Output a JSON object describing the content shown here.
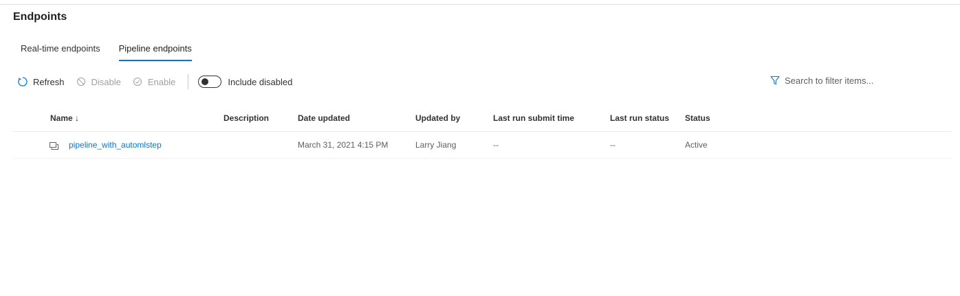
{
  "page": {
    "title": "Endpoints"
  },
  "tabs": [
    {
      "label": "Real-time endpoints",
      "active": false
    },
    {
      "label": "Pipeline endpoints",
      "active": true
    }
  ],
  "toolbar": {
    "refresh_label": "Refresh",
    "disable_label": "Disable",
    "enable_label": "Enable",
    "include_disabled_label": "Include disabled",
    "include_disabled_on": false
  },
  "search": {
    "placeholder": "Search to filter items..."
  },
  "table": {
    "columns": [
      "Name ↓",
      "Description",
      "Date updated",
      "Updated by",
      "Last run submit time",
      "Last run status",
      "Status"
    ],
    "rows": [
      {
        "name": "pipeline_with_automlstep",
        "description": "",
        "date_updated": "March 31, 2021 4:15 PM",
        "updated_by": "Larry Jiang",
        "last_run_submit_time": "--",
        "last_run_status": "--",
        "status": "Active"
      }
    ]
  },
  "colors": {
    "accent": "#0078d4",
    "text": "#323130",
    "disabled": "#a19f9d"
  },
  "icons": [
    "refresh-icon",
    "disable-icon",
    "enable-icon",
    "filter-icon",
    "pipeline-icon"
  ]
}
